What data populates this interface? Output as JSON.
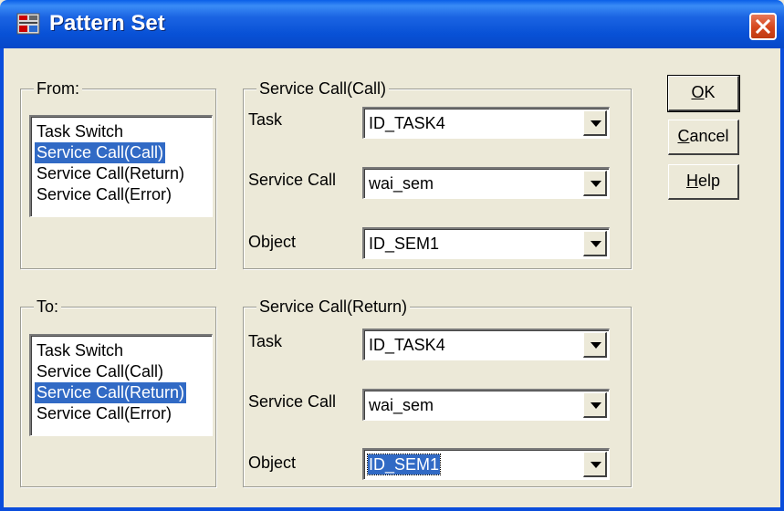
{
  "window": {
    "title": "Pattern Set"
  },
  "from": {
    "legend": "From:",
    "items": [
      "Task Switch",
      "Service Call(Call)",
      "Service Call(Return)",
      "Service Call(Error)"
    ],
    "selected_index": 1
  },
  "to": {
    "legend": "To:",
    "items": [
      "Task Switch",
      "Service Call(Call)",
      "Service Call(Return)",
      "Service Call(Error)"
    ],
    "selected_index": 2
  },
  "call_group": {
    "legend": "Service Call(Call)",
    "task_label": "Task",
    "task_value": "ID_TASK4",
    "service_label": "Service Call",
    "service_value": "wai_sem",
    "object_label": "Object",
    "object_value": "ID_SEM1"
  },
  "return_group": {
    "legend": "Service Call(Return)",
    "task_label": "Task",
    "task_value": "ID_TASK4",
    "service_label": "Service Call",
    "service_value": "wai_sem",
    "object_label": "Object",
    "object_value": "ID_SEM1"
  },
  "buttons": {
    "ok": {
      "mnemonic": "O",
      "rest": "K"
    },
    "cancel": {
      "mnemonic": "C",
      "rest": "ancel"
    },
    "help": {
      "mnemonic": "H",
      "rest": "elp"
    }
  },
  "colors": {
    "title_bar": "#0a5fe8",
    "selection": "#316ac5",
    "dialog_bg": "#ece9d8",
    "close_button": "#d5451b"
  },
  "icons": {
    "title": "application-icon",
    "close": "close-icon",
    "dropdown": "chevron-down-icon"
  }
}
